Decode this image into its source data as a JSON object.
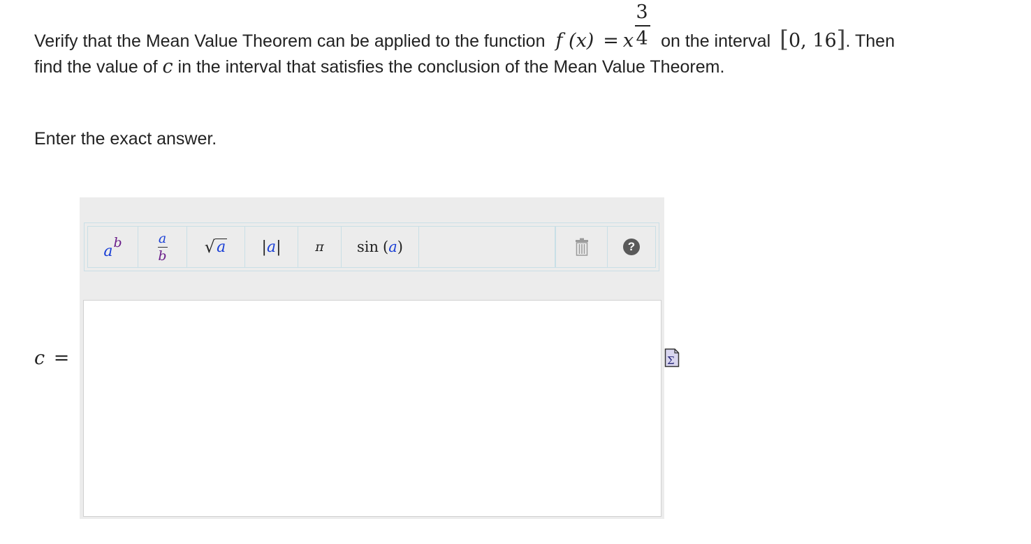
{
  "question": {
    "line1_prefix": "Verify that the Mean Value Theorem can be applied to the function",
    "function_lhs": "f (x)",
    "equals": "=",
    "function_base": "x",
    "exponent_numerator": "3",
    "exponent_denominator": "4",
    "line1_middle": "on the interval",
    "interval_open": "[",
    "interval_values": "0, 16",
    "interval_close": "]",
    "line1_suffix": ". Then",
    "line2_prefix": "find the value of",
    "line2_variable": "c",
    "line2_suffix": "in the interval that satisfies the conclusion of the Mean Value Theorem."
  },
  "instruction": "Enter the exact answer.",
  "toolbar": {
    "power": {
      "base": "a",
      "exponent": "b"
    },
    "fraction": {
      "numerator": "a",
      "denominator": "b"
    },
    "sqrt": {
      "radical": "√",
      "arg": "a"
    },
    "abs": {
      "left": "|",
      "arg": "a",
      "right": "|"
    },
    "pi": "π",
    "sin": {
      "name": "sin",
      "open": "(",
      "arg": "a",
      "close": ")"
    },
    "trash_icon": "trash-icon",
    "help_icon": "question-mark-icon",
    "help_glyph": "?"
  },
  "answer": {
    "variable": "c",
    "equals": "=",
    "value": ""
  },
  "equation_editor_icon": "sigma-icon",
  "colors": {
    "blue": "#1a3fd6",
    "purple": "#6b1f8a",
    "panel": "#ececec",
    "toolbar_border": "#c9dfe6"
  }
}
